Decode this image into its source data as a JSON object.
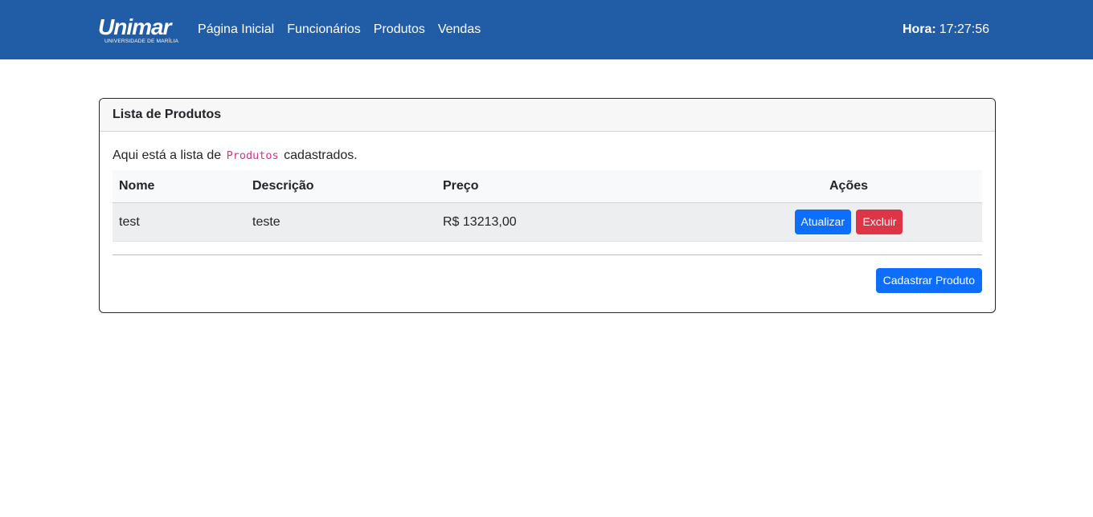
{
  "navbar": {
    "logo": {
      "name": "Unimar",
      "subtitle": "UNIVERSIDADE DE MARÍLIA"
    },
    "links": [
      "Página Inicial",
      "Funcionários",
      "Produtos",
      "Vendas"
    ],
    "clock": {
      "label": "Hora:",
      "value": "17:27:56"
    }
  },
  "card": {
    "title": "Lista de Produtos",
    "intro": {
      "prefix": "Aqui está a lista de",
      "code": "Produtos",
      "suffix": "cadastrados."
    },
    "table": {
      "headers": [
        "Nome",
        "Descrição",
        "Preço",
        "Ações"
      ],
      "rows": [
        {
          "nome": "test",
          "descricao": "teste",
          "preco": "R$ 13213,00",
          "update_label": "Atualizar",
          "delete_label": "Excluir"
        }
      ]
    },
    "create_button": "Cadastrar Produto"
  },
  "colors": {
    "navbar": "#215ca7",
    "primary": "#0d6efd",
    "danger": "#dc3545",
    "code": "#d63384"
  }
}
